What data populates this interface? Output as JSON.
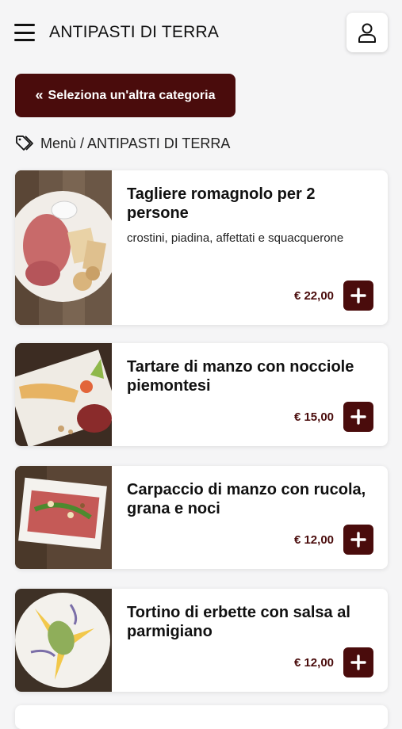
{
  "header": {
    "title": "ANTIPASTI DI TERRA",
    "menu_icon": "hamburger-icon",
    "user_icon": "user-icon"
  },
  "category_button": {
    "chevron": "«",
    "label": "Seleziona un'altra categoria"
  },
  "breadcrumb": {
    "icon": "tag-icon",
    "text": "Menù / ANTIPASTI DI TERRA"
  },
  "colors": {
    "accent": "#4a0c0c",
    "background": "#f5f5f6",
    "card": "#ffffff"
  },
  "items": [
    {
      "name": "Tagliere romagnolo per 2 persone",
      "description": "crostini, piadina, affettati e squacquerone",
      "price": "€ 22,00"
    },
    {
      "name": "Tartare di manzo con nocciole piemontesi",
      "description": "",
      "price": "€ 15,00"
    },
    {
      "name": "Carpaccio di manzo con rucola, grana e noci",
      "description": "",
      "price": "€ 12,00"
    },
    {
      "name": "Tortino di erbette con salsa al parmigiano",
      "description": "",
      "price": "€ 12,00"
    }
  ]
}
